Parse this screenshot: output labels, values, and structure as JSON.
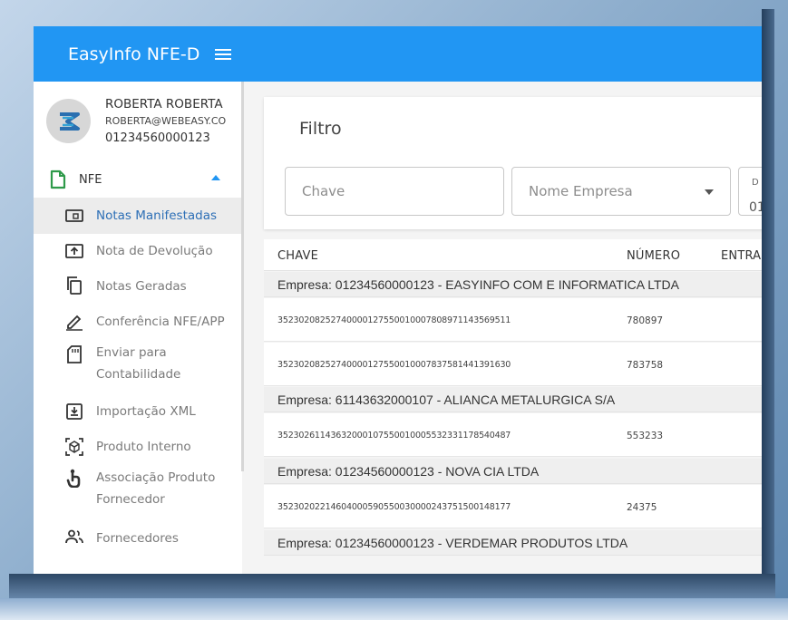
{
  "app": {
    "title": "EasyInfo NFE-D"
  },
  "user": {
    "name": "ROBERTA ROBERTA",
    "email": "ROBERTA@WEBEASY.CO",
    "cnpj": "01234560000123"
  },
  "sidebar": {
    "section_label": "NFE",
    "items": [
      {
        "label": "Notas Manifestadas",
        "icon": "document-icon",
        "active": true
      },
      {
        "label": "Nota de Devolução",
        "icon": "upload-box-icon",
        "active": false
      },
      {
        "label": "Notas Geradas",
        "icon": "copy-icon",
        "active": false
      },
      {
        "label": "Conferência NFE/APP",
        "icon": "pencil-icon",
        "active": false
      },
      {
        "label": "Enviar para",
        "label2": "Contabilidade",
        "icon": "sd-card-icon",
        "active": false
      },
      {
        "label": "Importação XML",
        "icon": "download-box-icon",
        "active": false
      },
      {
        "label": "Produto Interno",
        "icon": "package-scan-icon",
        "active": false
      },
      {
        "label": "Associação Produto",
        "label2": "Fornecedor",
        "icon": "touch-icon",
        "active": false
      },
      {
        "label": "Fornecedores",
        "icon": "people-icon",
        "active": false
      }
    ]
  },
  "filter": {
    "title": "Filtro",
    "key_placeholder": "Chave",
    "company_placeholder": "Nome Empresa",
    "date_label": "D",
    "date_value": "01"
  },
  "table": {
    "headers": {
      "key": "CHAVE",
      "number": "NÚMERO",
      "entry": "ENTRA"
    },
    "groups": [
      {
        "label": "Empresa:  01234560000123  -  EASYINFO COM E INFORMATICA LTDA",
        "rows": [
          {
            "key": "35230208252740000127550010007808971143569511",
            "number": "780897"
          },
          {
            "key": "35230208252740000127550010007837581441391630",
            "number": "783758"
          }
        ]
      },
      {
        "label": "Empresa: 61143632000107 - ALIANCA METALURGICA S/A",
        "rows": [
          {
            "key": "35230261143632000107550010005532331178540487",
            "number": "553233"
          }
        ]
      },
      {
        "label": "Empresa:  01234560000123  -  NOVA CIA LTDA",
        "rows": [
          {
            "key": "35230202214604000590550030000243751500148177",
            "number": "24375"
          }
        ]
      },
      {
        "label": "Empresa:  01234560000123  -  VERDEMAR PRODUTOS LTDA",
        "rows": []
      }
    ]
  },
  "colors": {
    "primary": "#2196f3",
    "active_text": "#2d6fb6",
    "nfe_icon": "#2e9a4a"
  }
}
